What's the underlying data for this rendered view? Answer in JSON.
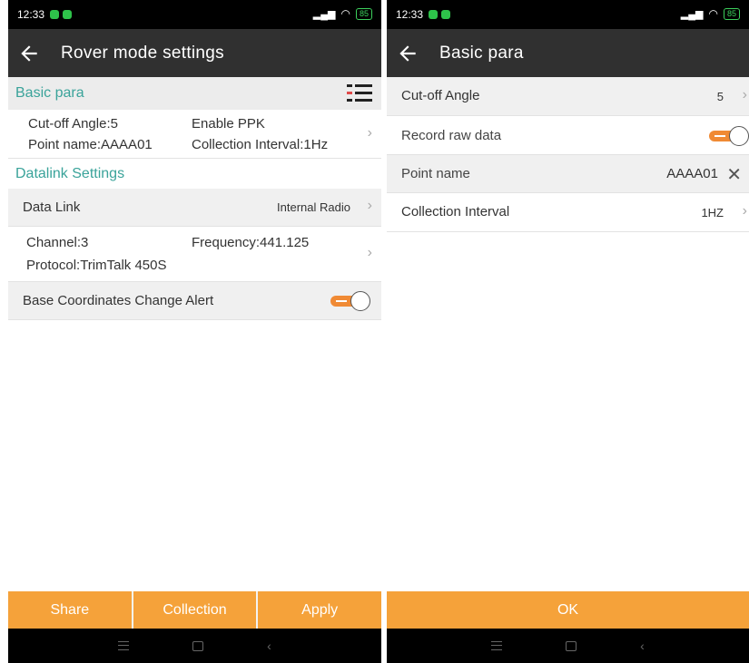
{
  "left": {
    "status": {
      "time": "12:33",
      "battery": "85"
    },
    "appbar": {
      "title": "Rover mode settings"
    },
    "basic_para": {
      "header": "Basic para",
      "cutoff": "Cut-off Angle:5",
      "enable_ppk": "Enable PPK",
      "point_name": "Point name:AAAA01",
      "collection_interval": "Collection Interval:1Hz"
    },
    "datalink": {
      "header": "Datalink Settings",
      "data_link_label": "Data Link",
      "data_link_value": "Internal Radio",
      "channel": "Channel:3",
      "frequency": "Frequency:441.125",
      "protocol": "Protocol:TrimTalk 450S",
      "base_alert_label": "Base Coordinates Change Alert",
      "base_alert_on": true
    },
    "buttons": {
      "share": "Share",
      "collection": "Collection",
      "apply": "Apply"
    }
  },
  "right": {
    "status": {
      "time": "12:33",
      "battery": "85"
    },
    "appbar": {
      "title": "Basic para"
    },
    "rows": {
      "cutoff_label": "Cut-off Angle",
      "cutoff_value": "5",
      "record_label": "Record raw data",
      "record_on": true,
      "point_label": "Point name",
      "point_value": "AAAA01",
      "interval_label": "Collection Interval",
      "interval_value": "1HZ"
    },
    "buttons": {
      "ok": "OK"
    }
  },
  "colors": {
    "accent": "#f5a23a",
    "toggle": "#f08a34",
    "section_text": "#3aa39a",
    "appbar": "#303030"
  }
}
